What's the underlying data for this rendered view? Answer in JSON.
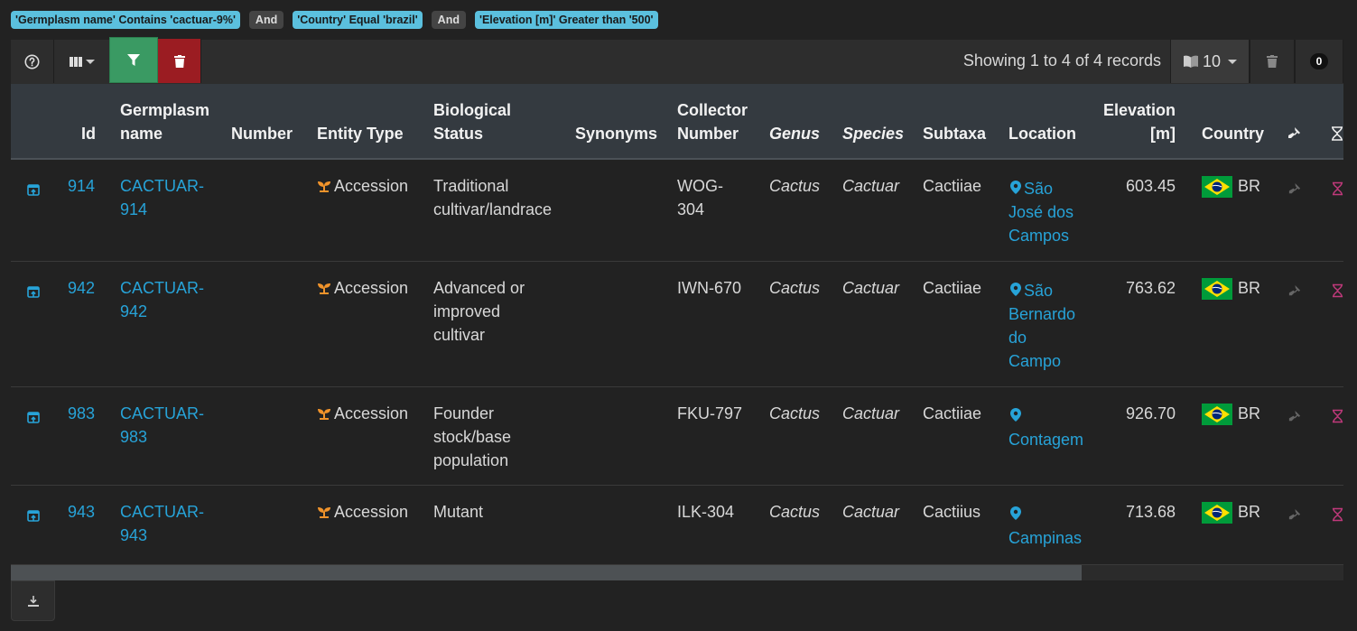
{
  "filters": [
    {
      "type": "filter",
      "text": "'Germplasm name' Contains 'cactuar-9%'"
    },
    {
      "type": "op",
      "text": "And"
    },
    {
      "type": "filter",
      "text": "'Country' Equal 'brazil'"
    },
    {
      "type": "op",
      "text": "And"
    },
    {
      "type": "filter",
      "text": "'Elevation [m]' Greater than '500'"
    }
  ],
  "toolbar": {
    "records_text": "Showing 1 to 4 of 4 records",
    "page_size": "10",
    "count": "0"
  },
  "columns": {
    "id": "Id",
    "germplasm_name_1": "Germplasm",
    "germplasm_name_2": "name",
    "number": "Number",
    "entity_type": "Entity Type",
    "bio_status_1": "Biological",
    "bio_status_2": "Status",
    "synonyms": "Synonyms",
    "collector_1": "Collector",
    "collector_2": "Number",
    "genus": "Genus",
    "species": "Species",
    "subtaxa": "Subtaxa",
    "location": "Location",
    "elevation_1": "Elevation",
    "elevation_2": "[m]",
    "country": "Country"
  },
  "rows": [
    {
      "id": "914",
      "name1": "CACTUAR-",
      "name2": "914",
      "entity": "Accession",
      "status": [
        "Traditional",
        "cultivar/landrace"
      ],
      "collector": [
        "WOG-",
        "304"
      ],
      "genus": "Cactus",
      "species": "Cactuar",
      "subtaxa": "Cactiiae",
      "location": [
        "São",
        "José dos",
        "Campos"
      ],
      "elevation": "603.45",
      "country": "BR"
    },
    {
      "id": "942",
      "name1": "CACTUAR-",
      "name2": "942",
      "entity": "Accession",
      "status": [
        "Advanced or",
        "improved",
        "cultivar"
      ],
      "collector": [
        "IWN-670"
      ],
      "genus": "Cactus",
      "species": "Cactuar",
      "subtaxa": "Cactiiae",
      "location": [
        "São",
        "Bernardo",
        "do",
        "Campo"
      ],
      "elevation": "763.62",
      "country": "BR"
    },
    {
      "id": "983",
      "name1": "CACTUAR-",
      "name2": "983",
      "entity": "Accession",
      "status": [
        "Founder",
        "stock/base",
        "population"
      ],
      "collector": [
        "FKU-797"
      ],
      "genus": "Cactus",
      "species": "Cactuar",
      "subtaxa": "Cactiiae",
      "location": [
        "",
        "Contagem"
      ],
      "elevation": "926.70",
      "country": "BR"
    },
    {
      "id": "943",
      "name1": "CACTUAR-",
      "name2": "943",
      "entity": "Accession",
      "status": [
        "Mutant"
      ],
      "collector": [
        "ILK-304"
      ],
      "genus": "Cactus",
      "species": "Cactuar",
      "subtaxa": "Cactiius",
      "location": [
        "",
        "Campinas"
      ],
      "elevation": "713.68",
      "country": "BR"
    }
  ],
  "colors": {
    "link": "#27a3d8",
    "filter_chip": "#5bc0de",
    "filter_btn": "#3a9a63",
    "clear_btn": "#9b1c22",
    "accession_icon": "#f0932b",
    "hourglass": "#c0397b"
  }
}
